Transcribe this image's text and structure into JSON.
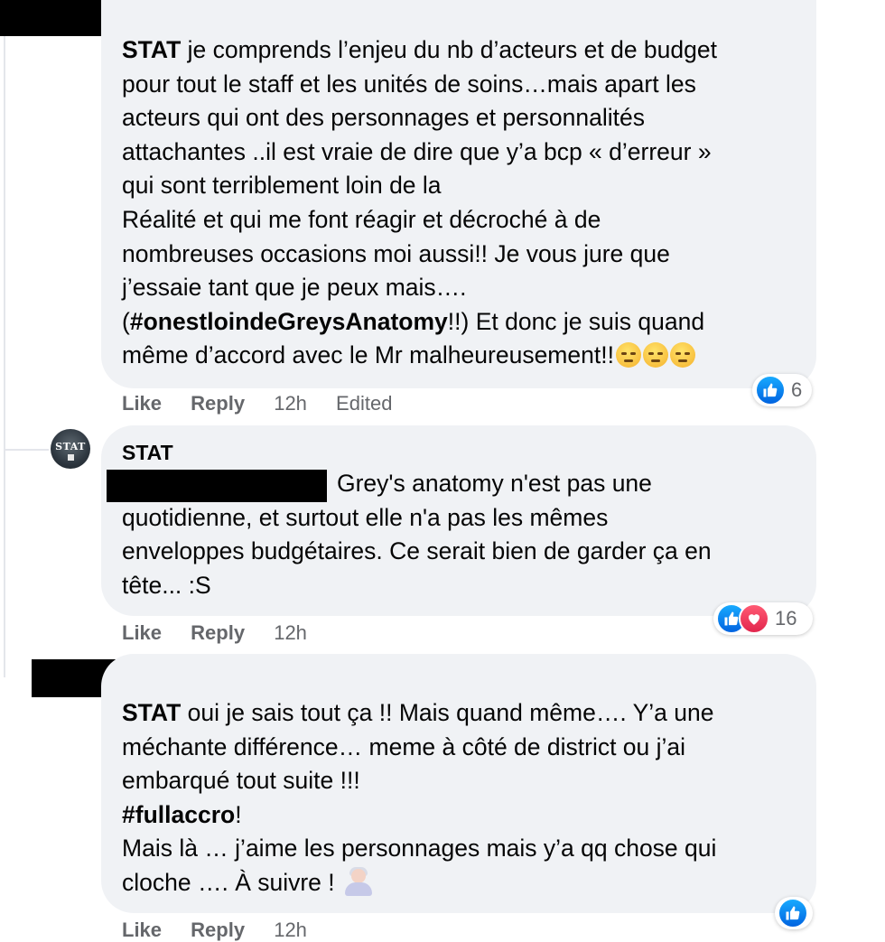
{
  "comments": [
    {
      "author_redacted": true,
      "lines": [
        [
          {
            "t": "STAT",
            "b": true
          },
          {
            "t": " je comprends l’enjeu du nb d’acteurs et de budget"
          }
        ],
        [
          {
            "t": "pour tout le staff et les unités de soins…mais apart les"
          }
        ],
        [
          {
            "t": "acteurs qui ont des personnages et personnalités"
          }
        ],
        [
          {
            "t": "attachantes ..il est vraie de dire que y’a bcp « d’erreur »"
          }
        ],
        [
          {
            "t": "qui sont terriblement loin de la"
          }
        ],
        [
          {
            "t": "Réalité et qui me font réagir et décroché à de"
          }
        ],
        [
          {
            "t": "nombreuses occasions moi aussi!! Je vous jure que"
          }
        ],
        [
          {
            "t": "j’essaie tant que je peux mais…."
          }
        ],
        [
          {
            "t": "("
          },
          {
            "t": "#onestloindeGreysAnatomy",
            "b": true
          },
          {
            "t": "!!) Et donc je suis quand"
          }
        ],
        [
          {
            "t": "même d’accord avec le Mr malheureusement!!"
          }
        ]
      ],
      "emojis": [
        "pensive-face-emoji",
        "unamused-face-emoji",
        "smirking-face-emoji"
      ],
      "actions": {
        "like": "Like",
        "reply": "Reply",
        "time": "12h",
        "edited": "Edited"
      },
      "reactions": {
        "types": [
          "like"
        ],
        "count": "6"
      }
    },
    {
      "author": "STAT",
      "avatar_text": "STAT",
      "lines": [
        [
          {
            "t": "Grey's anatomy n'est pas une"
          }
        ],
        [
          {
            "t": "quotidienne, et surtout elle n'a pas les mêmes"
          }
        ],
        [
          {
            "t": "enveloppes budgétaires. Ce serait bien de garder ça en"
          }
        ],
        [
          {
            "t": "tête... :S"
          }
        ]
      ],
      "actions": {
        "like": "Like",
        "reply": "Reply",
        "time": "12h"
      },
      "reactions": {
        "types": [
          "like",
          "love"
        ],
        "count": "16"
      }
    },
    {
      "author_redacted": true,
      "lines": [
        [
          {
            "t": "STAT",
            "b": true
          },
          {
            "t": " oui je sais tout ça !! Mais quand même…. Y’a une"
          }
        ],
        [
          {
            "t": "méchante différence… meme à côté de district ou j’ai"
          }
        ],
        [
          {
            "t": "embarqué tout suite !!!"
          }
        ],
        [
          {
            "t": "#fullaccro",
            "b": true
          },
          {
            "t": "!"
          }
        ],
        [
          {
            "t": "Mais là … j’aime les personnages mais y’a qq chose qui"
          }
        ],
        [
          {
            "t": "cloche …. À suivre ! "
          }
        ]
      ],
      "emojis": [
        "person-shrugging-emoji"
      ],
      "actions": {
        "like": "Like",
        "reply": "Reply",
        "time": "12h"
      },
      "reactions": {
        "types": [
          "like"
        ],
        "count": ""
      }
    }
  ],
  "colors": {
    "bubble": "#f0f2f5",
    "meta_text": "#65676b",
    "like_blue": "#1877f2",
    "love_red": "#f33e58",
    "thread_line": "#e4e6eb"
  }
}
